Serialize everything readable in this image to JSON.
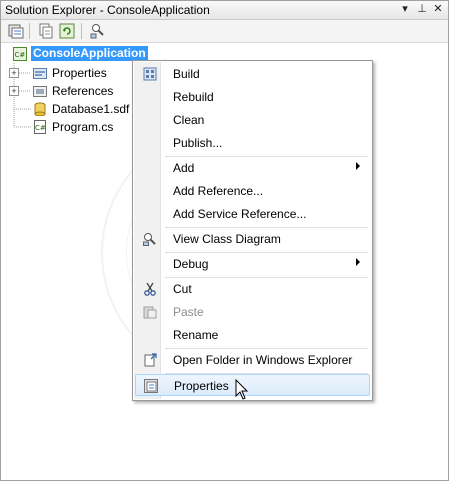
{
  "window": {
    "title": "Solution Explorer - ConsoleApplication",
    "buttons": {
      "dropdown": "▾",
      "pin": "⊥",
      "close": "✕"
    }
  },
  "toolbar": {
    "buttons": [
      "solution-properties-icon",
      "show-all-files-icon",
      "refresh-icon",
      "view-class-diagram-icon"
    ]
  },
  "tree": {
    "root": {
      "label": "ConsoleApplication",
      "icon": "csharp-project-icon",
      "selected": true
    },
    "children": [
      {
        "label": "Properties",
        "icon": "properties-folder-icon",
        "expandable": true
      },
      {
        "label": "References",
        "icon": "references-icon",
        "expandable": true
      },
      {
        "label": "Database1.sdf",
        "icon": "database-icon",
        "expandable": false
      },
      {
        "label": "Program.cs",
        "icon": "csharp-file-icon",
        "expandable": false
      }
    ]
  },
  "context_menu": {
    "items": [
      {
        "label": "Build",
        "icon": "build-icon",
        "enabled": true
      },
      {
        "label": "Rebuild",
        "enabled": true
      },
      {
        "label": "Clean",
        "enabled": true
      },
      {
        "label": "Publish...",
        "enabled": true
      },
      {
        "label": "Add",
        "enabled": true,
        "submenu": true
      },
      {
        "label": "Add Reference...",
        "enabled": true
      },
      {
        "label": "Add Service Reference...",
        "enabled": true
      },
      {
        "label": "View Class Diagram",
        "icon": "class-diagram-icon",
        "enabled": true
      },
      {
        "label": "Debug",
        "enabled": true,
        "submenu": true
      },
      {
        "label": "Cut",
        "icon": "scissors-icon",
        "enabled": true
      },
      {
        "label": "Paste",
        "icon": "paste-icon",
        "enabled": false
      },
      {
        "label": "Rename",
        "enabled": true
      },
      {
        "label": "Open Folder in Windows Explorer",
        "icon": "open-folder-icon",
        "enabled": true
      },
      {
        "label": "Properties",
        "icon": "properties-icon",
        "enabled": true,
        "highlighted": true
      }
    ]
  },
  "colors": {
    "selection": "#3399ff",
    "menu_highlight_border": "#a8d8ff",
    "disabled_text": "#8d8d8d"
  }
}
